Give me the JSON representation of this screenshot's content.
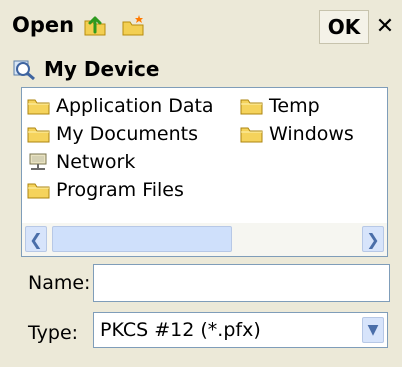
{
  "toolbar": {
    "title": "Open",
    "ok_label": "OK",
    "close_label": "✕"
  },
  "location": {
    "path": "My Device"
  },
  "file_list": {
    "items": [
      {
        "label": "Application Data",
        "icon": "folder-icon"
      },
      {
        "label": "My Documents",
        "icon": "folder-icon"
      },
      {
        "label": "Network",
        "icon": "network-icon"
      },
      {
        "label": "Program Files",
        "icon": "folder-icon"
      },
      {
        "label": "Temp",
        "icon": "folder-icon"
      },
      {
        "label": "Windows",
        "icon": "folder-icon"
      }
    ]
  },
  "form": {
    "name_label": "Name:",
    "name_value": "",
    "type_label": "Type:",
    "type_value": "PKCS #12 (*.pfx)"
  },
  "colors": {
    "background": "#ece9d8",
    "border": "#7f9db9",
    "scroll_accent": "#d7e4fb"
  }
}
